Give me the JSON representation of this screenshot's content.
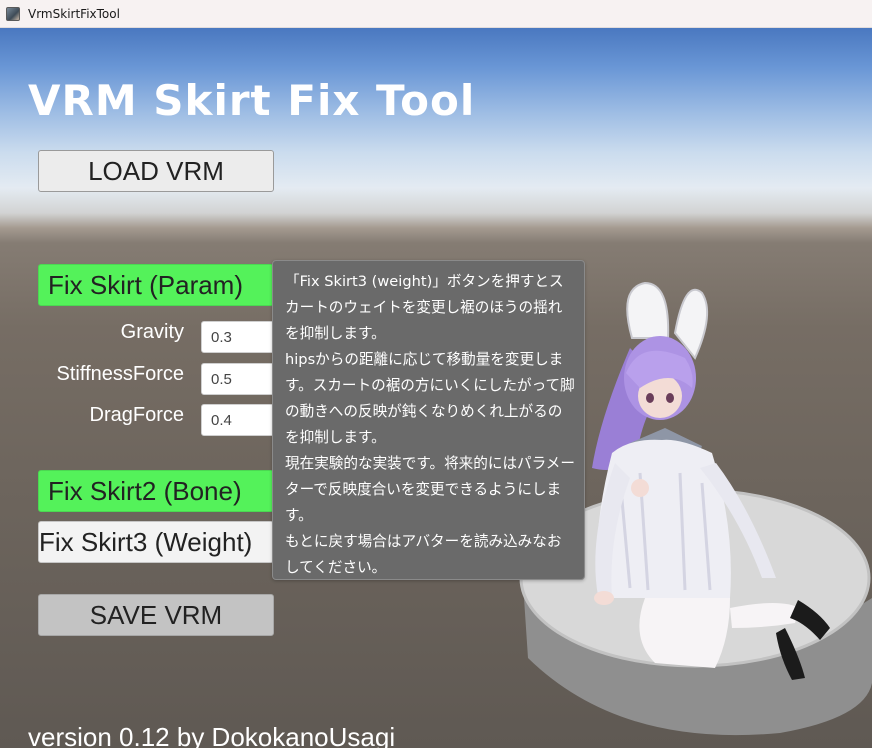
{
  "window": {
    "title": "VrmSkirtFixTool",
    "icon": "app-icon"
  },
  "header": {
    "title": "VRM Skirt Fix Tool"
  },
  "buttons": {
    "load": "LOAD VRM",
    "fix_param": "Fix Skirt (Param)",
    "fix_bone": "Fix Skirt2 (Bone)",
    "fix_weight": "Fix Skirt3 (Weight)",
    "save": "SAVE VRM"
  },
  "params": [
    {
      "label": "Gravity",
      "value": "0.3"
    },
    {
      "label": "StiffnessForce",
      "value": "0.5"
    },
    {
      "label": "DragForce",
      "value": "0.4"
    }
  ],
  "tooltip": {
    "text": "「Fix Skirt3 (weight)」ボタンを押すとスカートのウェイトを変更し裾のほうの揺れを抑制します。\nhipsからの距離に応じて移動量を変更します。スカートの裾の方にいくにしたがって脚の動きへの反映が鈍くなりめくれ上がるのを抑制します。\n現在実験的な実装です。将来的にはパラメーターで反映度合いを変更できるようにします。\nもとに戻す場合はアバターを読み込みなおしてください。"
  },
  "footer": {
    "version": "version 0.12 by DokokanoUsagi"
  },
  "colors": {
    "green_button": "#54f25a",
    "tooltip_bg": "#6a6a6a",
    "title_text": "#ffffff"
  }
}
